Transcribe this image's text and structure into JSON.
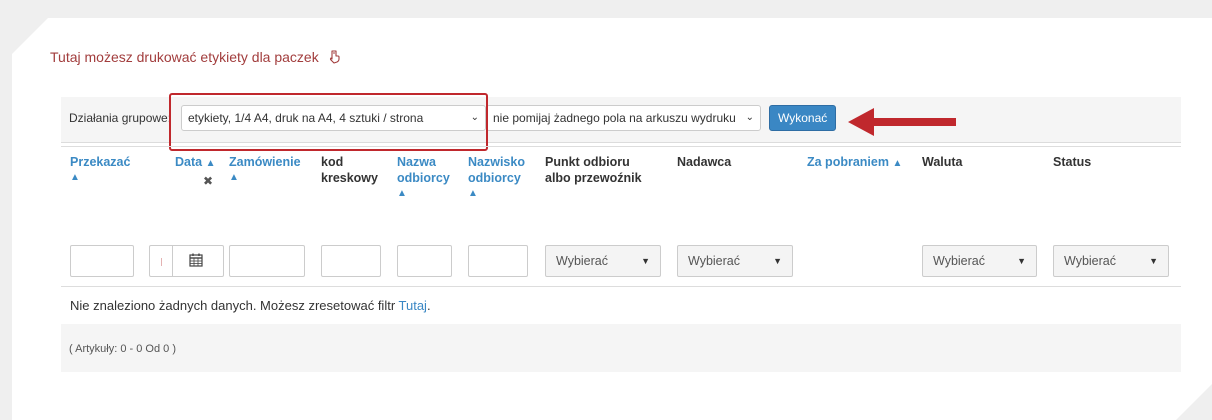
{
  "heading": {
    "text": "Tutaj możesz drukować etykiety dla paczek",
    "icon": "hand-pointing-down-icon"
  },
  "toolbar": {
    "label": "Działania grupowe:",
    "action_select": "etykiety, 1/4 A4, druk na A4, 4 sztuki / strona",
    "skip_select": "nie pomijaj żadnego pola na arkuszu wydruku",
    "execute": "Wykonać"
  },
  "columns": {
    "transfer": "Przekazać",
    "date": "Data",
    "order": "Zamówienie",
    "barcode_1": "kod",
    "barcode_2": "kreskowy",
    "recipient_name_1": "Nazwa",
    "recipient_name_2": "odbiorcy",
    "recipient_surname_1": "Nazwisko",
    "recipient_surname_2": "odbiorcy",
    "pickup_1": "Punkt odbioru",
    "pickup_2": "albo przewoźnik",
    "sender": "Nadawca",
    "cod": "Za pobraniem",
    "currency": "Waluta",
    "status": "Status"
  },
  "filters": {
    "pickup": "Wybierać",
    "sender": "Wybierać",
    "currency": "Wybierać",
    "status": "Wybierać"
  },
  "empty": {
    "text": "Nie znaleziono żadnych danych. Możesz zresetować filtr ",
    "link": "Tutaj",
    "end": "."
  },
  "footer": {
    "text": "( Artykuły: 0 - 0 Od 0 )"
  },
  "colors": {
    "accent": "#3a87c4",
    "highlight": "#c0282d",
    "heading": "#a23d3d"
  }
}
